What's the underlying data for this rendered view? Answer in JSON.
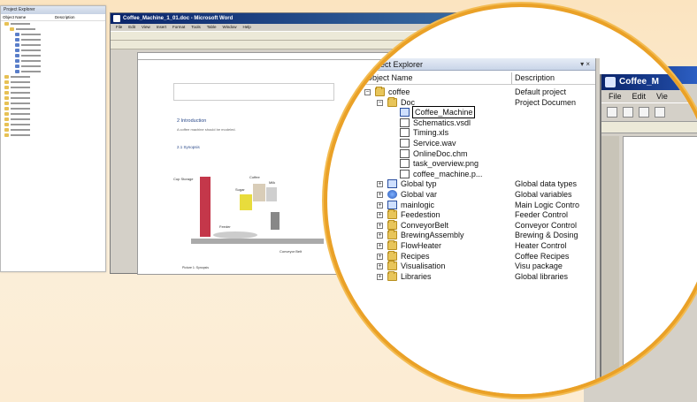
{
  "mini_explorer": {
    "title": "Project Explorer",
    "col_name": "Object Name",
    "col_desc": "Description"
  },
  "word": {
    "title": "Coffee_Machine_1_01.doc - Microsoft Word",
    "menu": [
      "File",
      "Edit",
      "View",
      "Insert",
      "Format",
      "Tools",
      "Table",
      "Window",
      "Help"
    ],
    "heading": "2 Introduction",
    "subheading": "2.1 Synopsis",
    "body_line": "A coffee machine should be modeled.",
    "diagram_labels": {
      "cup_storage": "Cup Storage",
      "coffee": "Coffee",
      "sugar": "Sugar",
      "milk": "Milk",
      "feeder": "Feeder",
      "conveyor": "Conveyor Belt",
      "figure_caption": "Picture 1: Synopsis"
    }
  },
  "project_explorer": {
    "title": "Project Explorer",
    "controls": "▾  ×",
    "col_name": "Object Name",
    "col_desc": "Description",
    "items": [
      {
        "label": "coffee",
        "desc": "Default project",
        "icon": "folder-icon"
      },
      {
        "label": "Doc",
        "desc": "Project Documen",
        "icon": "folder-icon"
      },
      {
        "label": "Coffee_Machine",
        "desc": "",
        "icon": "word-doc-icon"
      },
      {
        "label": "Schematics.vsdl",
        "desc": "",
        "icon": "visio-doc-icon"
      },
      {
        "label": "Timing.xls",
        "desc": "",
        "icon": "excel-doc-icon"
      },
      {
        "label": "Service.wav",
        "desc": "",
        "icon": "audio-file-icon"
      },
      {
        "label": "OnlineDoc.chm",
        "desc": "",
        "icon": "help-file-icon"
      },
      {
        "label": "task_overview.png",
        "desc": "",
        "icon": "image-file-icon"
      },
      {
        "label": "coffee_machine.p...",
        "desc": "",
        "icon": "pdf-file-icon"
      },
      {
        "label": "Global typ",
        "desc": "Global data types",
        "icon": "types-icon"
      },
      {
        "label": "Global var",
        "desc": "Global variables",
        "icon": "globe-icon"
      },
      {
        "label": "mainlogic",
        "desc": "Main Logic Contro",
        "icon": "program-icon"
      },
      {
        "label": "Feedestion",
        "desc": "Feeder Control",
        "icon": "folder-icon"
      },
      {
        "label": "ConveyorBelt",
        "desc": "Conveyor Control",
        "icon": "folder-icon"
      },
      {
        "label": "BrewingAssembly",
        "desc": "Brewing & Dosing",
        "icon": "folder-icon"
      },
      {
        "label": "FlowHeater",
        "desc": "Heater Control",
        "icon": "folder-icon"
      },
      {
        "label": "Recipes",
        "desc": "Coffee Recipes",
        "icon": "folder-icon"
      },
      {
        "label": "Visualisation",
        "desc": "Visu package",
        "icon": "folder-icon"
      },
      {
        "label": "Libraries",
        "desc": "Global libraries",
        "icon": "folder-icon"
      }
    ]
  },
  "coffee_window": {
    "title": "Coffee_M",
    "menu": [
      "File",
      "Edit",
      "Vie"
    ]
  },
  "colors": {
    "lens_border": "#eaa127",
    "title_bar": "#0a246a",
    "folder": "#e8c55a"
  }
}
